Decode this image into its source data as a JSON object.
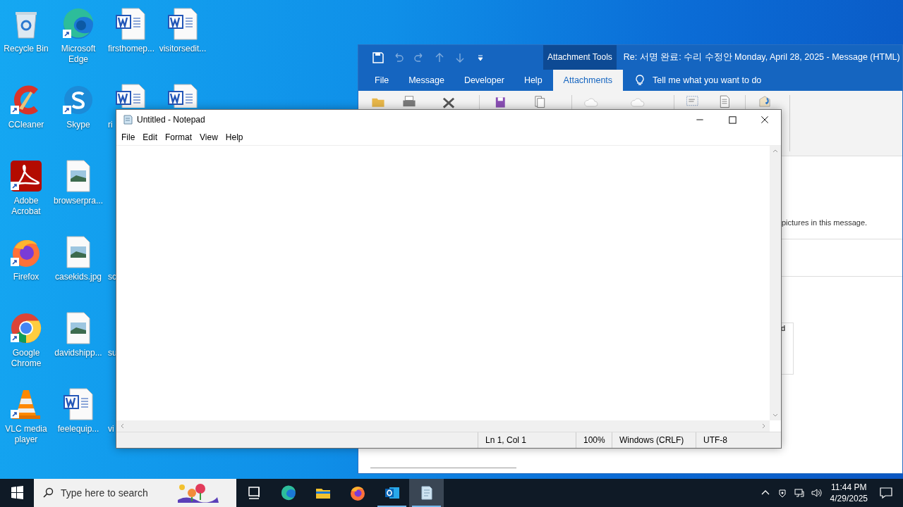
{
  "desktop_icons": [
    {
      "label": "Recycle Bin",
      "kind": "recycle",
      "shortcut": false
    },
    {
      "label": "CCleaner",
      "kind": "ccleaner",
      "shortcut": true
    },
    {
      "label": "Adobe Acrobat",
      "kind": "acrobat",
      "shortcut": true
    },
    {
      "label": "Firefox",
      "kind": "firefox",
      "shortcut": true
    },
    {
      "label": "Google Chrome",
      "kind": "chrome",
      "shortcut": true
    },
    {
      "label": "VLC media player",
      "kind": "vlc",
      "shortcut": true
    },
    {
      "label": "Microsoft Edge",
      "kind": "edge",
      "shortcut": true
    },
    {
      "label": "Skype",
      "kind": "skype",
      "shortcut": true
    },
    {
      "label": "browserpra...",
      "kind": "image",
      "shortcut": false
    },
    {
      "label": "casekids.jpg",
      "kind": "image",
      "shortcut": false
    },
    {
      "label": "davidshipp...",
      "kind": "image",
      "shortcut": false
    },
    {
      "label": "feelequip...",
      "kind": "word",
      "shortcut": false
    },
    {
      "label": "firsthomep...",
      "kind": "word",
      "shortcut": false
    },
    {
      "label": "ri",
      "kind": "word",
      "shortcut": false
    },
    {
      "label": "sc"
    },
    {
      "label": "su"
    },
    {
      "label": "vi"
    },
    {
      "label": "visitorsedit...",
      "kind": "word",
      "shortcut": false
    },
    {
      "kind": "word",
      "shortcut": false
    }
  ],
  "outlook": {
    "contextual_tab": "Attachment Tools",
    "title": "Re: 서명 완료: 수리 수정안  Monday, April 28, 2025  -  Message (HTML)",
    "tabs": [
      {
        "label": "File",
        "selected": false
      },
      {
        "label": "Message",
        "selected": false
      },
      {
        "label": "Developer",
        "selected": false
      },
      {
        "label": "Help",
        "selected": false
      },
      {
        "label": "Attachments",
        "selected": true
      }
    ],
    "tell_me": "Tell me what you want to do",
    "info_text": "pictures in this message.",
    "box_text": "d"
  },
  "notepad": {
    "title": "Untitled - Notepad",
    "menu": [
      "File",
      "Edit",
      "Format",
      "View",
      "Help"
    ],
    "status": [
      "Ln 1, Col 1",
      "100%",
      "Windows (CRLF)",
      "UTF-8"
    ]
  },
  "taskbar": {
    "search": {
      "placeholder": "Type here to search"
    },
    "apps": [
      {
        "kind": "taskview",
        "running": false,
        "selected": false
      },
      {
        "kind": "edge",
        "running": false,
        "selected": false
      },
      {
        "kind": "explorer",
        "running": false,
        "selected": false
      },
      {
        "kind": "firefox",
        "running": false,
        "selected": false
      },
      {
        "kind": "outlook",
        "running": true,
        "selected": false
      },
      {
        "kind": "notepad",
        "running": true,
        "selected": true
      }
    ],
    "time": "11:44 PM",
    "date": "4/29/2025"
  }
}
